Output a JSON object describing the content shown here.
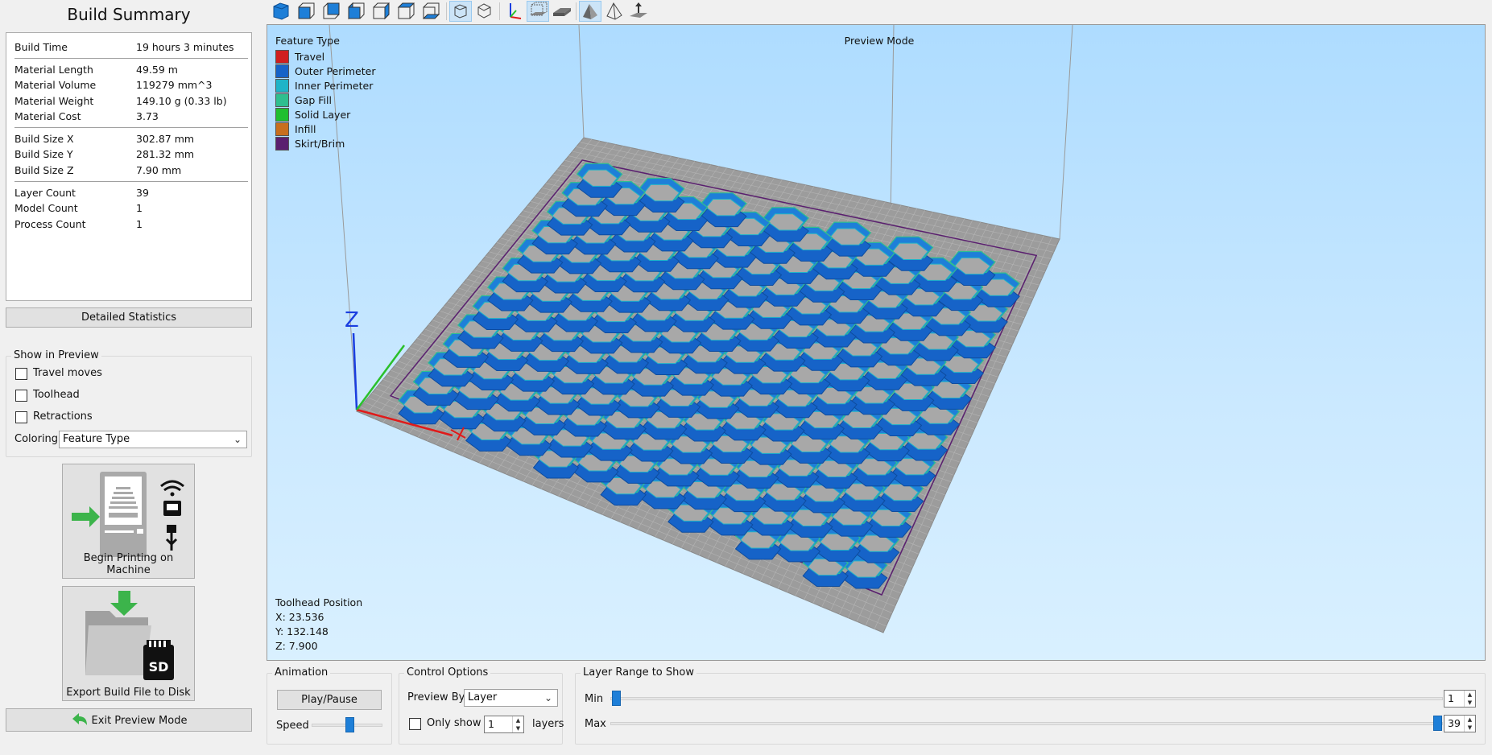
{
  "left_panel": {
    "title": "Build Summary",
    "stats": [
      {
        "label": "Build Time",
        "value": "19 hours 3 minutes"
      },
      {
        "label": "Material Length",
        "value": "49.59 m"
      },
      {
        "label": "Material Volume",
        "value": "119279 mm^3"
      },
      {
        "label": "Material Weight",
        "value": "149.10 g (0.33 lb)"
      },
      {
        "label": "Material Cost",
        "value": "3.73"
      },
      {
        "label": "Build Size X",
        "value": "302.87 mm"
      },
      {
        "label": "Build Size Y",
        "value": "281.32 mm"
      },
      {
        "label": "Build Size Z",
        "value": "7.90 mm"
      },
      {
        "label": "Layer Count",
        "value": "39"
      },
      {
        "label": "Model Count",
        "value": "1"
      },
      {
        "label": "Process Count",
        "value": "1"
      }
    ],
    "detailed_stats_label": "Detailed Statistics",
    "show_in_preview": {
      "title": "Show in Preview",
      "options": [
        {
          "label": "Travel moves",
          "checked": false
        },
        {
          "label": "Toolhead",
          "checked": false
        },
        {
          "label": "Retractions",
          "checked": false
        }
      ],
      "coloring_label": "Coloring",
      "coloring_value": "Feature Type"
    },
    "begin_printing_label": "Begin Printing on Machine",
    "export_label": "Export Build File to Disk",
    "sd_text": "SD",
    "exit_label": "Exit Preview Mode"
  },
  "toolbar": {
    "buttons": [
      {
        "icon": "iso-view-icon",
        "active": false
      },
      {
        "icon": "front-view-icon",
        "active": false
      },
      {
        "icon": "back-view-icon",
        "active": false
      },
      {
        "icon": "left-view-icon",
        "active": false
      },
      {
        "icon": "right-view-icon",
        "active": false
      },
      {
        "icon": "top-view-icon",
        "active": false
      },
      {
        "icon": "bottom-view-icon",
        "active": false
      },
      {
        "icon": "perspective-icon",
        "active": true
      },
      {
        "icon": "orthographic-icon",
        "active": false
      },
      {
        "icon": "axes-icon",
        "active": false
      },
      {
        "icon": "build-volume-icon",
        "active": true
      },
      {
        "icon": "bed-icon",
        "active": false
      },
      {
        "icon": "solid-shading-icon",
        "active": true
      },
      {
        "icon": "wireframe-icon",
        "active": false
      },
      {
        "icon": "origin-icon",
        "active": false
      }
    ]
  },
  "viewport": {
    "legend_title": "Feature Type",
    "legend": [
      {
        "label": "Travel",
        "color": "#d01f1f"
      },
      {
        "label": "Outer Perimeter",
        "color": "#1663c8"
      },
      {
        "label": "Inner Perimeter",
        "color": "#1fb4c8"
      },
      {
        "label": "Gap Fill",
        "color": "#2fbf8f"
      },
      {
        "label": "Solid Layer",
        "color": "#1fbf2f"
      },
      {
        "label": "Infill",
        "color": "#c86f1f"
      },
      {
        "label": "Skirt/Brim",
        "color": "#5a1f6f"
      }
    ],
    "mode_label": "Preview Mode",
    "toolhead_title": "Toolhead Position",
    "toolhead_x": "X: 23.536",
    "toolhead_y": "Y: 132.148",
    "toolhead_z": "Z: 7.900",
    "axis_z_label": "Z"
  },
  "animation": {
    "title": "Animation",
    "play_label": "Play/Pause",
    "speed_label": "Speed",
    "speed_level": 0.55
  },
  "control_options": {
    "title": "Control Options",
    "preview_by_label": "Preview By",
    "preview_by_value": "Layer",
    "only_show_label": "Only show",
    "only_show_value": "1",
    "layers_label": "layers"
  },
  "layer_range": {
    "title": "Layer Range to Show",
    "min_label": "Min",
    "max_label": "Max",
    "min_value": "1",
    "max_value": "39",
    "min_level": 0.0,
    "max_level": 1.0
  }
}
